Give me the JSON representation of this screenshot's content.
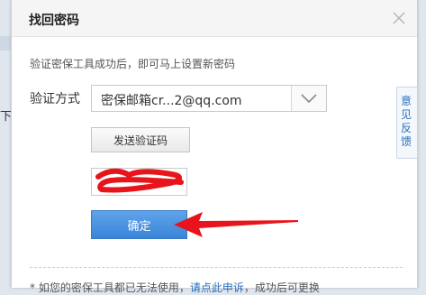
{
  "background": {
    "left_text": "下"
  },
  "dialog": {
    "title": "找回密码",
    "tip": "验证密保工具成功后，即可马上设置新密码",
    "verify_label": "验证方式",
    "method_value": "密保邮箱cr...2@qq.com",
    "send_code_label": "发送验证码",
    "confirm_label": "确定",
    "footer": {
      "prefix": "* 如您的密保工具都已无法使用，",
      "link": "请点此申诉",
      "suffix": "，成功后可更换"
    }
  },
  "side_tab": {
    "label": "意见反馈"
  },
  "colors": {
    "accent": "#3a85d9",
    "annotation_red": "#e8141b",
    "link": "#2a6fbd"
  },
  "icons": {
    "close": "close-icon",
    "dropdown": "chevron-down-icon"
  }
}
